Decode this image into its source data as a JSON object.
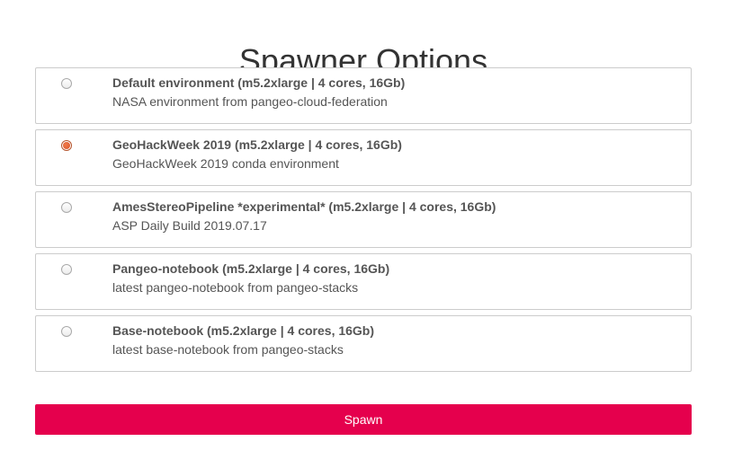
{
  "page": {
    "title": "Spawner Options"
  },
  "options": [
    {
      "title": "Default environment (m5.2xlarge | 4 cores, 16Gb)",
      "description": "NASA environment from pangeo-cloud-federation",
      "selected": false
    },
    {
      "title": "GeoHackWeek 2019 (m5.2xlarge | 4 cores, 16Gb)",
      "description": "GeoHackWeek 2019 conda environment",
      "selected": true
    },
    {
      "title": "AmesStereoPipeline *experimental* (m5.2xlarge | 4 cores, 16Gb)",
      "description": "ASP Daily Build 2019.07.17",
      "selected": false
    },
    {
      "title": "Pangeo-notebook (m5.2xlarge | 4 cores, 16Gb)",
      "description": "latest pangeo-notebook from pangeo-stacks",
      "selected": false
    },
    {
      "title": "Base-notebook (m5.2xlarge | 4 cores, 16Gb)",
      "description": "latest base-notebook from pangeo-stacks",
      "selected": false
    }
  ],
  "spawn": {
    "label": "Spawn"
  },
  "colors": {
    "button_bg": "#e5004d",
    "radio_selected": "#d9532a",
    "border": "#cccccc",
    "text": "#555555"
  }
}
